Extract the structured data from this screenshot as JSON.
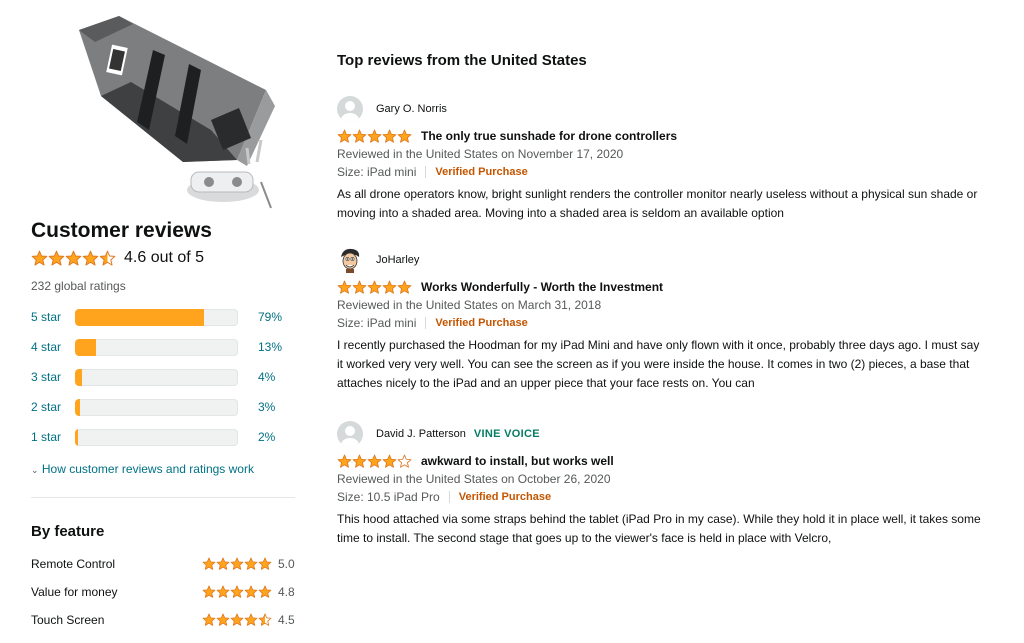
{
  "product": {
    "image_icon": "drone-controller-sunshade-image"
  },
  "summary": {
    "title": "Customer reviews",
    "average_text": "4.6 out of 5",
    "average_stars": 4.5,
    "global_ratings": "232 global ratings",
    "histogram": [
      {
        "label": "5 star",
        "percent_text": "79%",
        "fraction": 0.79
      },
      {
        "label": "4 star",
        "percent_text": "13%",
        "fraction": 0.13
      },
      {
        "label": "3 star",
        "percent_text": "4%",
        "fraction": 0.04
      },
      {
        "label": "2 star",
        "percent_text": "3%",
        "fraction": 0.03
      },
      {
        "label": "1 star",
        "percent_text": "2%",
        "fraction": 0.02
      }
    ],
    "how_link": "How customer reviews and ratings work"
  },
  "by_feature": {
    "title": "By feature",
    "items": [
      {
        "name": "Remote Control",
        "score": "5.0",
        "stars": 5
      },
      {
        "name": "Value for money",
        "score": "4.8",
        "stars": 5
      },
      {
        "name": "Touch Screen",
        "score": "4.5",
        "stars": 4.5
      }
    ]
  },
  "reviews_section": {
    "title": "Top reviews from the United States",
    "reviews": [
      {
        "name": "Gary O. Norris",
        "badge": "",
        "avatar_icon": "default-avatar-icon",
        "stars": 5,
        "title": "The only true sunshade for drone controllers",
        "date": "Reviewed in the United States on November 17, 2020",
        "size": "Size: iPad mini",
        "verified": "Verified Purchase",
        "body": "As all drone operators know, bright sunlight renders the controller monitor nearly useless without a physical sun shade or moving into a shaded area. Moving into a shaded area is seldom an available option"
      },
      {
        "name": "JoHarley",
        "badge": "",
        "avatar_icon": "cartoon-face-avatar-icon",
        "stars": 5,
        "title": "Works Wonderfully - Worth the Investment",
        "date": "Reviewed in the United States on March 31, 2018",
        "size": "Size: iPad mini",
        "verified": "Verified Purchase",
        "body": "I recently purchased the Hoodman for my iPad Mini and have only flown with it once, probably three days ago. I must say it worked very very well. You can see the screen as if you were inside the house. It comes in two (2) pieces, a base that attaches nicely to the iPad and an upper piece that your face rests on. You can"
      },
      {
        "name": "David J. Patterson",
        "badge": "VINE VOICE",
        "avatar_icon": "default-avatar-icon",
        "stars": 4,
        "title": "awkward to install, but works well",
        "date": "Reviewed in the United States on October 26, 2020",
        "size": "Size: 10.5 iPad Pro",
        "verified": "Verified Purchase",
        "body": "This hood attached via some straps behind the tablet (iPad Pro in my case). While they hold it in place well, it takes some time to install. The second stage that goes up to the viewer's face is held in place with Velcro,"
      }
    ]
  },
  "colors": {
    "star": "#ffa41c",
    "star_border": "#de7921",
    "link": "#007185",
    "verified": "#c45500",
    "vine": "#067d62"
  }
}
